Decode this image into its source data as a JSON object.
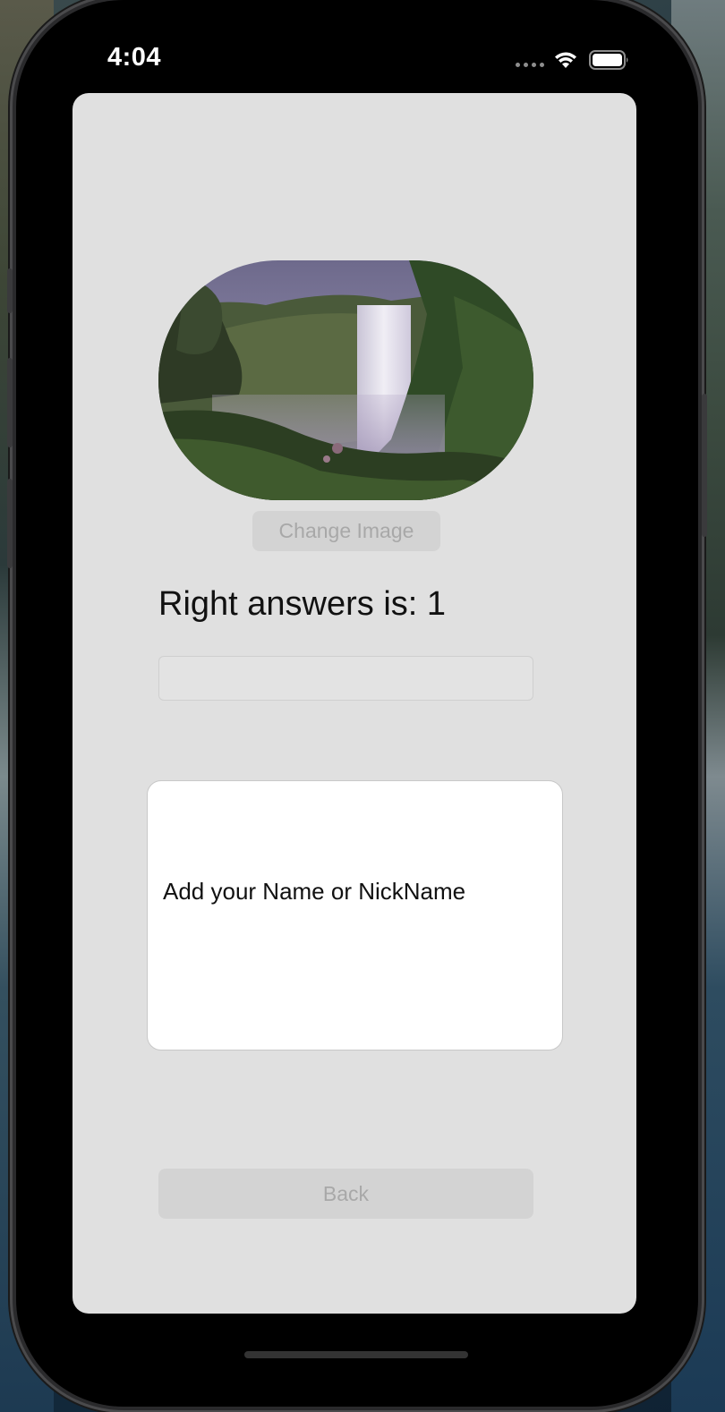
{
  "status_bar": {
    "time": "4:04"
  },
  "profile": {
    "avatar_description_icon": "waterfall-photo",
    "change_image_label": "Change Image",
    "answers_text": "Right answers is: 1",
    "text_field_value": "",
    "name_prompt": "Add your Name or NickName",
    "back_label": "Back"
  },
  "colors": {
    "screen_background": "#e0e0e0",
    "disabled_button_bg": "#d3d3d3",
    "disabled_button_text": "#a8a8a8",
    "card_background": "#ffffff"
  }
}
